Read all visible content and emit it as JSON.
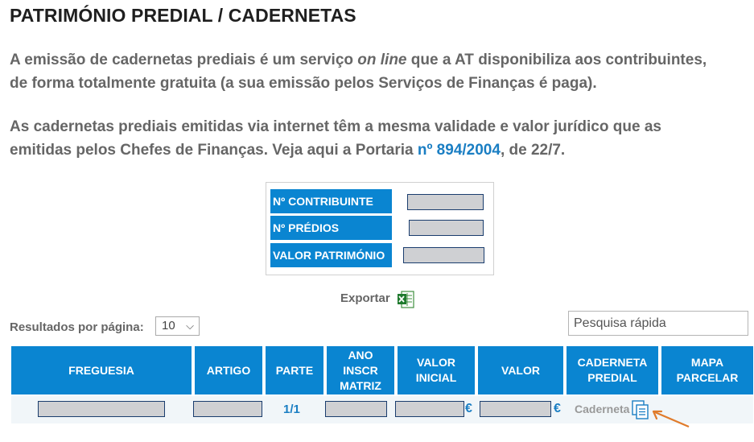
{
  "title": "PATRIMÓNIO PREDIAL / CADERNETAS",
  "intro": {
    "p1_line1_a": "A emissão de cadernetas prediais é um serviço ",
    "p1_line1_em": "on line",
    "p1_line1_b": " que a AT disponibiliza aos contribuintes,",
    "p1_line2": "de forma totalmente gratuita (a sua emissão pelos Serviços de Finanças é paga).",
    "p2_line1": "As cadernetas prediais emitidas via internet têm a mesma validade e valor jurídico que as",
    "p2_line2_a": "emitidas pelos Chefes de Finanças. Veja aqui a Portaria ",
    "p2_line2_link": "nº 894/2004",
    "p2_line2_b": ", de 22/7."
  },
  "summary": {
    "contribuinte_label": "Nº CONTRIBUINTE",
    "predios_label": "Nº PRÉDIOS",
    "patrimonio_label": "VALOR PATRIMÓNIO"
  },
  "export": {
    "label": "Exportar",
    "icon": "excel-icon"
  },
  "pagination": {
    "label": "Resultados por página:",
    "value": "10"
  },
  "search": {
    "placeholder": "Pesquisa rápida"
  },
  "table": {
    "headers": {
      "freguesia": "FREGUESIA",
      "artigo": "ARTIGO",
      "parte": "PARTE",
      "ano_line1": "ANO",
      "ano_line2": "INSCR",
      "ano_line3": "MATRIZ",
      "valor_inicial_line1": "VALOR",
      "valor_inicial_line2": "INICIAL",
      "valor": "VALOR",
      "caderneta_line1": "CADERNETA",
      "caderneta_line2": "PREDIAL",
      "mapa_line1": "MAPA",
      "mapa_line2": "PARCELAR"
    },
    "rows": [
      {
        "parte": "1/1",
        "currency_1": "€",
        "currency_2": "€",
        "caderneta_link": "Caderneta"
      }
    ]
  },
  "colors": {
    "accent": "#0a85d1",
    "link": "#1a7ec3",
    "redacted": "#cfd0d3",
    "arrow": "#e07b2b"
  }
}
